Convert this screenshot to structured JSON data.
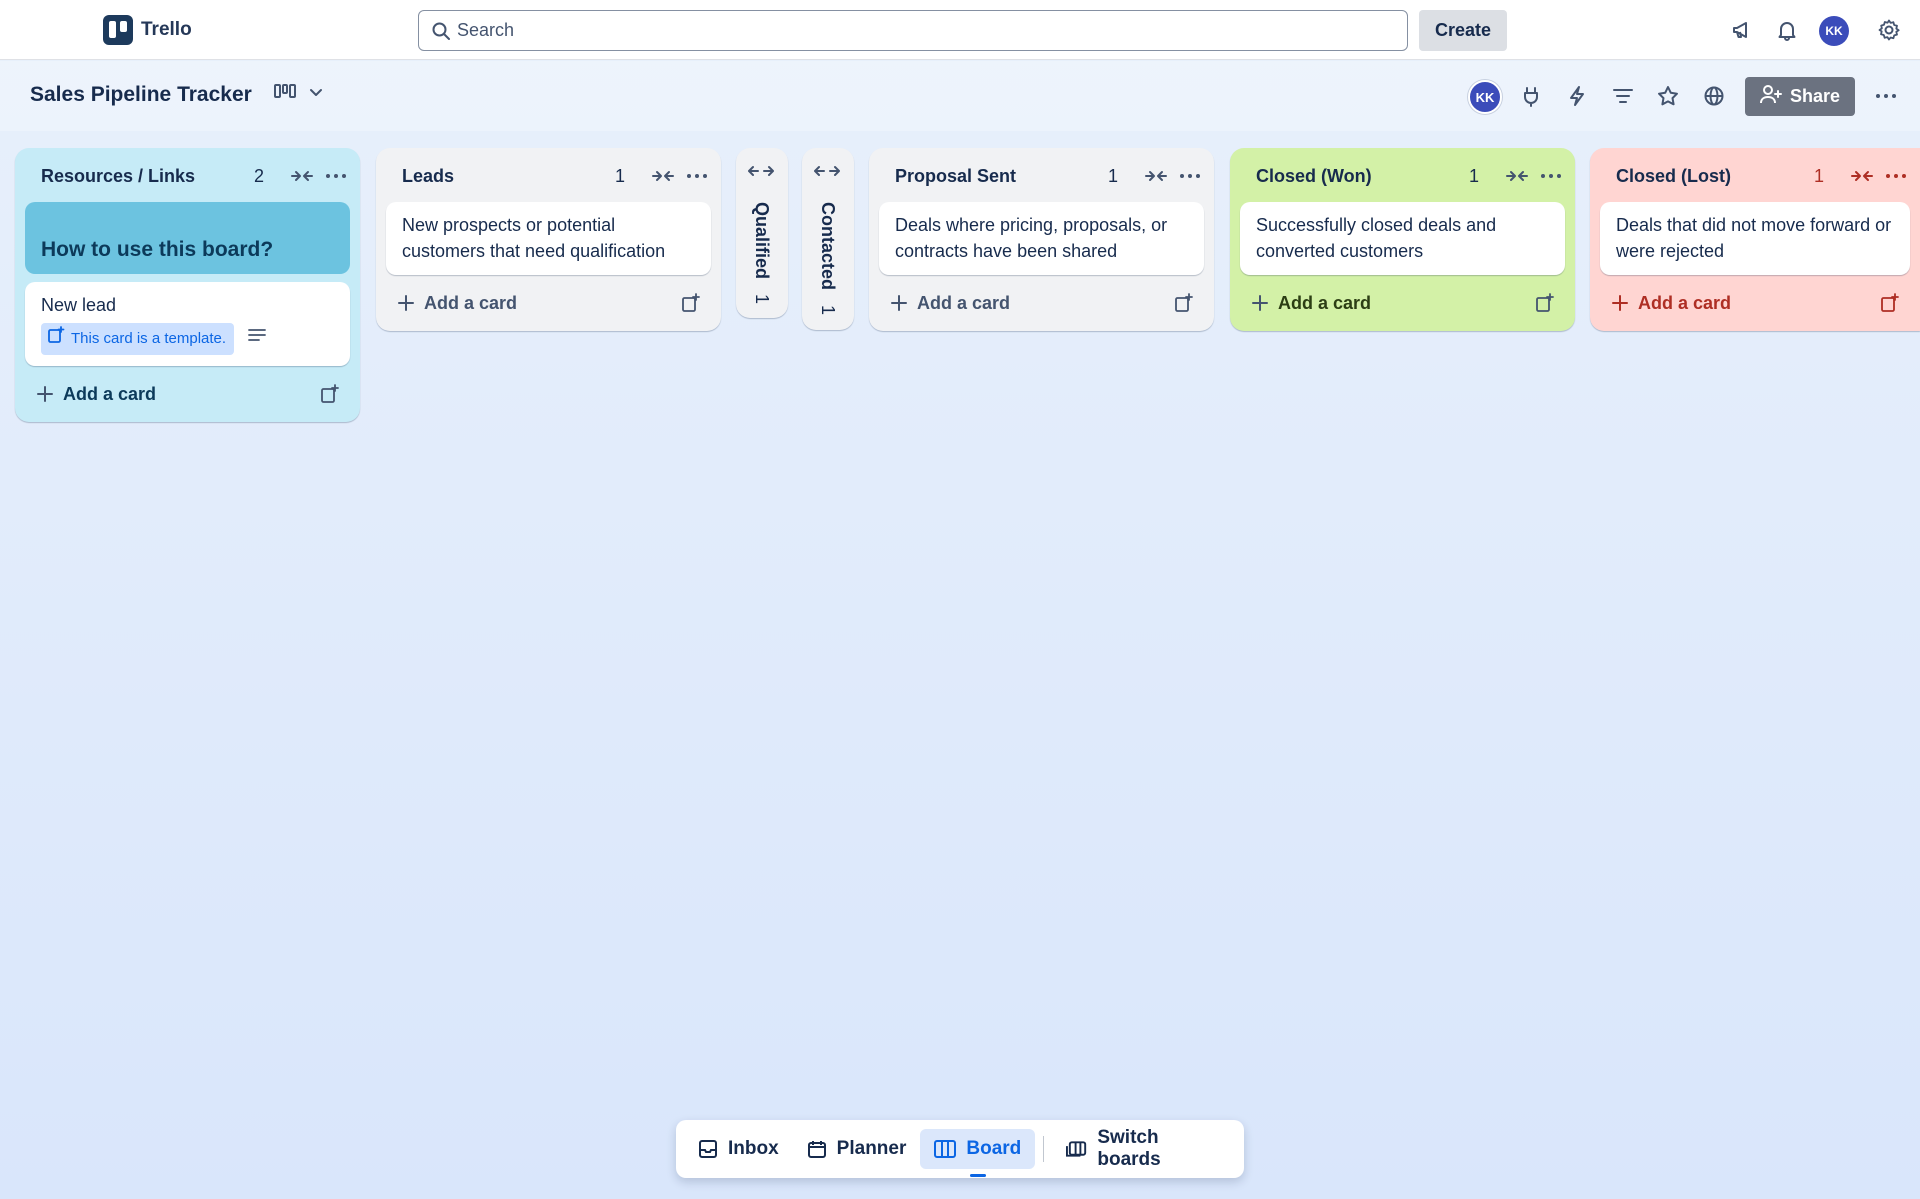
{
  "app": {
    "name": "Trello"
  },
  "header": {
    "search_placeholder": "Search",
    "create_label": "Create",
    "user_initials": "KK"
  },
  "board": {
    "title": "Sales Pipeline Tracker",
    "member_initials": "KK",
    "share_label": "Share"
  },
  "lists": {
    "resources": {
      "title": "Resources / Links",
      "count": "2",
      "cover_card": "How to use this board?",
      "card": "New lead",
      "template_badge": "This card is a template.",
      "add_label": "Add a card"
    },
    "leads": {
      "title": "Leads",
      "count": "1",
      "card": "New prospects or potential customers that need qualification",
      "add_label": "Add a card"
    },
    "qualified": {
      "title": "Qualified",
      "count": "1"
    },
    "contacted": {
      "title": "Contacted",
      "count": "1"
    },
    "proposal": {
      "title": "Proposal Sent",
      "count": "1",
      "card": "Deals where pricing, proposals, or contracts have been shared",
      "add_label": "Add a card"
    },
    "won": {
      "title": "Closed (Won)",
      "count": "1",
      "card": "Successfully closed deals and converted customers",
      "add_label": "Add a card"
    },
    "lost": {
      "title": "Closed (Lost)",
      "count": "1",
      "card": "Deals that did not move forward or were rejected",
      "add_label": "Add a card"
    }
  },
  "bottom_nav": {
    "inbox": "Inbox",
    "planner": "Planner",
    "board": "Board",
    "switch": "Switch boards"
  },
  "colors": {
    "resources_list": "#c6ebf7",
    "won_list": "#d3f1a7",
    "lost_list": "#ffd5d2",
    "accent": "#0c66e4"
  }
}
